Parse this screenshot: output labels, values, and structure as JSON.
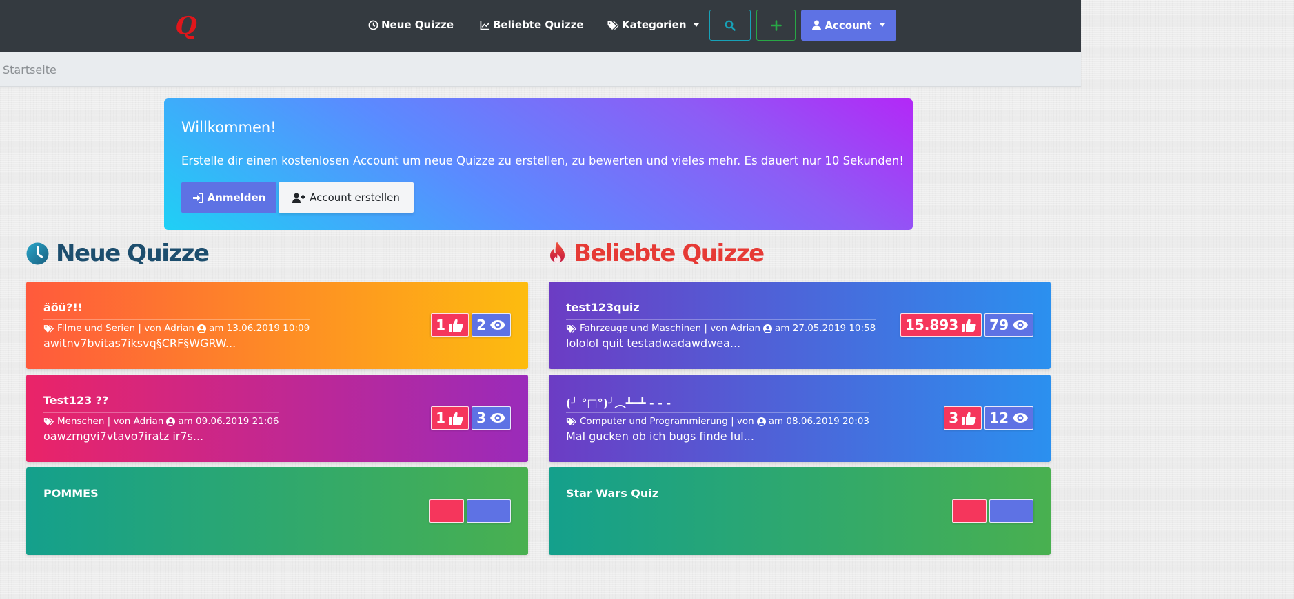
{
  "navbar": {
    "logo_letter": "Q",
    "links": [
      {
        "icon": "clock-icon",
        "label": "Neue Quizze"
      },
      {
        "icon": "chart-line-icon",
        "label": "Beliebte Quizze"
      },
      {
        "icon": "tags-icon",
        "label": "Kategorien"
      }
    ],
    "account_label": "Account",
    "colors": {
      "bg": "#343a40",
      "search_border": "#17a2b8",
      "add_border": "#28a745",
      "account_bg": "#5e72e4"
    }
  },
  "breadcrumb": {
    "current": "Startseite"
  },
  "welcome": {
    "title": "Willkommen!",
    "text": "Erstelle dir einen kostenlosen Account um neue Quizze zu erstellen, zu bewerten und vieles mehr. Es dauert nur 10 Sekunden!",
    "login_label": "Anmelden",
    "register_label": "Account erstellen"
  },
  "sections": {
    "new": {
      "title": "Neue Quizze",
      "icon": "clock-icon",
      "color": "#1d4e6e"
    },
    "popular": {
      "title": "Beliebte Quizze",
      "icon": "fire-icon",
      "color": "#e63a35"
    }
  },
  "new_quizzes": [
    {
      "title": "äöü?!!",
      "meta": "Filme und Serien | von Adrian",
      "date": "am 13.06.2019 10:09",
      "desc": "awitnv7bvitas7iksvq§CRF§WGRW...",
      "likes": "1",
      "views": "2"
    },
    {
      "title": "Test123 ??",
      "meta": "Menschen | von Adrian",
      "date": "am 09.06.2019 21:06",
      "desc": "oawzrngvi7vtavo7iratz ir7s...",
      "likes": "1",
      "views": "3"
    },
    {
      "title": "POMMES"
    }
  ],
  "popular_quizzes": [
    {
      "title": "test123quiz",
      "meta": "Fahrzeuge und Maschinen | von Adrian",
      "date": "am 27.05.2019 10:58",
      "desc": "lololol quit testadwadawdwea...",
      "likes": "15.893",
      "views": "79"
    },
    {
      "title": "(╯ °□°)╯︵┻━┻ - - -",
      "meta": "Computer und Programmierung | von",
      "date": "am 08.06.2019 20:03",
      "desc": "Mal gucken ob ich bugs finde lul...",
      "likes": "3",
      "views": "12"
    },
    {
      "title": "Star Wars Quiz"
    }
  ],
  "card_gradients": {
    "orange": [
      "#ff5b3b",
      "#fdbb0e"
    ],
    "pink": [
      "#e9246a",
      "#9a2bb8"
    ],
    "green": [
      "#14a08c",
      "#49b050"
    ],
    "purple": [
      "#6c3bc3",
      "#2e8ff0"
    ]
  },
  "badge_colors": {
    "like": "#f5365c",
    "view": "#5e72e4"
  }
}
